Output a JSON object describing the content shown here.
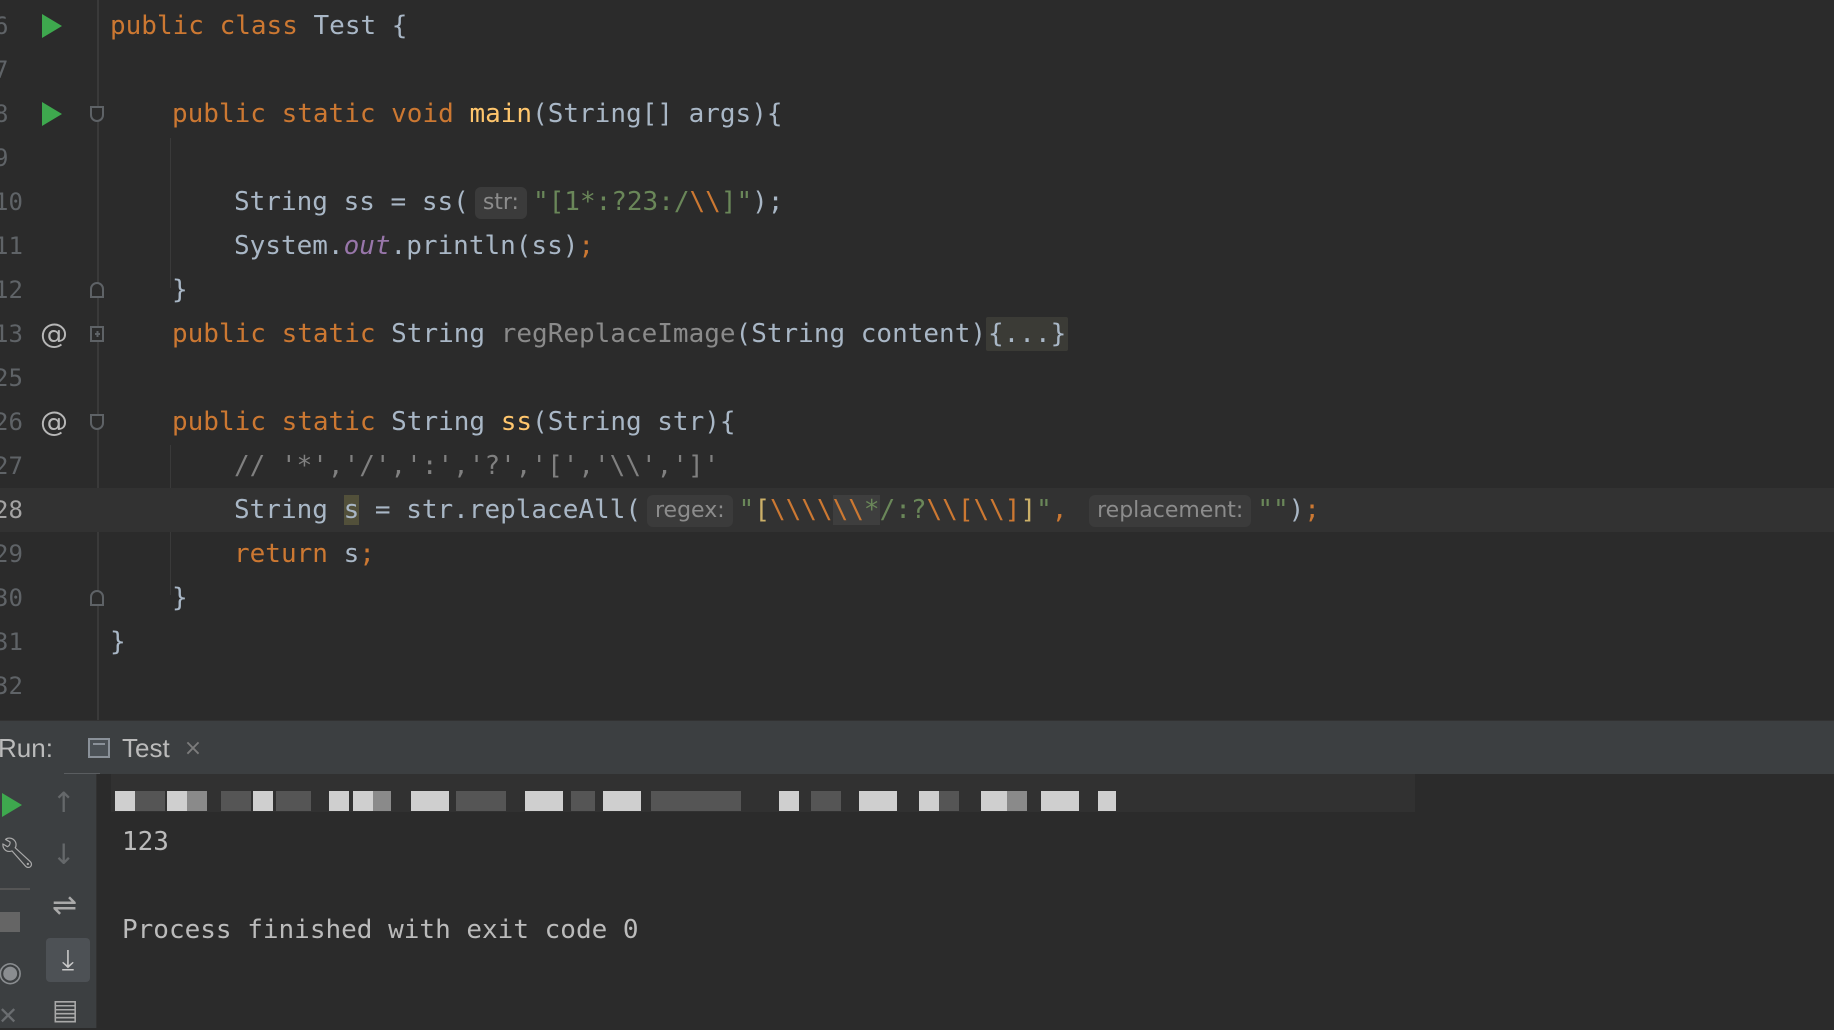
{
  "editor": {
    "line_numbers": [
      "6",
      "7",
      "8",
      "9",
      "10",
      "11",
      "12",
      "13",
      "25",
      "26",
      "27",
      "28",
      "29",
      "30",
      "31",
      "32"
    ],
    "code": {
      "l6": {
        "kw1": "public",
        "kw2": "class",
        "name": "Test",
        "brace": " {"
      },
      "l8": {
        "kw1": "public",
        "kw2": "static",
        "kw3": "void",
        "fn": "main",
        "rest": "(String[] args){"
      },
      "l10": {
        "pre": "String ss = ss(",
        "hint": "str:",
        "q1": "\"",
        "val": "[1*:?23:/",
        "esc": "\\\\",
        "val2": "]",
        "q2": "\"",
        "end": ");"
      },
      "l11": {
        "pre": "System.",
        "stat": "out",
        "rest": ".println(ss)",
        "semi": ";"
      },
      "l12": {
        "text": "}"
      },
      "l13": {
        "kw1": "public",
        "kw2": "static",
        "type": "String",
        "fn": "regReplaceImage",
        "rest": "(String content)",
        "folded": "{...}"
      },
      "l26": {
        "kw1": "public",
        "kw2": "static",
        "type": "String",
        "fn": "ss",
        "rest": "(String str){"
      },
      "l27": {
        "comment": "// '*','/',':','?','[','\\\\',']'"
      },
      "l28": {
        "pre": "String ",
        "sel": "s",
        "mid": " = str.replaceAll(",
        "hint1": "regex:",
        "q1": "\"",
        "b1": "[",
        "esc1": "\\\\\\\\",
        "esc2": "\\\\",
        "star": "*",
        "v1": "/:?",
        "esc3": "\\\\[",
        "esc4": "\\\\]",
        "b2": "]",
        "q2": "\"",
        "comma": ", ",
        "hint2": "replacement:",
        "q3": "\"\"",
        "end": ")",
        "semi": ";"
      },
      "l29": {
        "kw": "return",
        "rest": " s",
        "semi": ";"
      },
      "l30": {
        "text": "}"
      },
      "l31": {
        "text": "}"
      }
    }
  },
  "run_panel": {
    "label": "Run:",
    "tab_label": "Test",
    "close_glyph": "×",
    "icons": {
      "rerun": "run-icon",
      "up": "arrow-up-icon",
      "down": "arrow-down-icon",
      "wrench": "wrench-icon",
      "wrap": "soft-wrap-icon",
      "stop": "stop-icon",
      "scroll": "scroll-to-end-icon",
      "camera": "camera-icon",
      "print": "print-icon"
    },
    "glyphs": {
      "up": "↑",
      "down": "↓",
      "wrench": "🔧",
      "wrap": "⇌",
      "scroll": "⤓",
      "camera": "◉",
      "print": "▤",
      "x": "✕"
    },
    "console": {
      "output": "123",
      "exit_message": "Process finished with exit code 0"
    }
  },
  "colors": {
    "background": "#2b2b2b",
    "keyword": "#cc7832",
    "function": "#ffc66d",
    "string": "#6a8759",
    "run_green": "#3ea84e"
  }
}
